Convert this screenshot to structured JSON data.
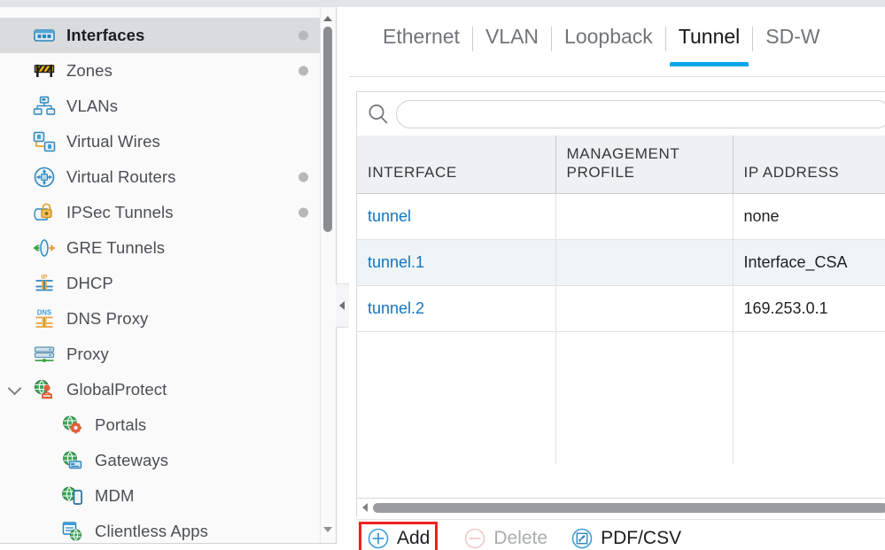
{
  "sidebar": {
    "items": [
      {
        "label": "Interfaces",
        "icon": "interfaces-icon",
        "selected": true,
        "dot": true,
        "child": false,
        "chevron": false
      },
      {
        "label": "Zones",
        "icon": "zones-icon",
        "selected": false,
        "dot": true,
        "child": false,
        "chevron": false
      },
      {
        "label": "VLANs",
        "icon": "vlans-icon",
        "selected": false,
        "dot": false,
        "child": false,
        "chevron": false
      },
      {
        "label": "Virtual Wires",
        "icon": "virtual-wires-icon",
        "selected": false,
        "dot": false,
        "child": false,
        "chevron": false
      },
      {
        "label": "Virtual Routers",
        "icon": "virtual-routers-icon",
        "selected": false,
        "dot": true,
        "child": false,
        "chevron": false
      },
      {
        "label": "IPSec Tunnels",
        "icon": "ipsec-tunnels-icon",
        "selected": false,
        "dot": true,
        "child": false,
        "chevron": false
      },
      {
        "label": "GRE Tunnels",
        "icon": "gre-tunnels-icon",
        "selected": false,
        "dot": false,
        "child": false,
        "chevron": false
      },
      {
        "label": "DHCP",
        "icon": "dhcp-icon",
        "selected": false,
        "dot": false,
        "child": false,
        "chevron": false
      },
      {
        "label": "DNS Proxy",
        "icon": "dns-proxy-icon",
        "selected": false,
        "dot": false,
        "child": false,
        "chevron": false
      },
      {
        "label": "Proxy",
        "icon": "proxy-icon",
        "selected": false,
        "dot": false,
        "child": false,
        "chevron": false
      },
      {
        "label": "GlobalProtect",
        "icon": "globalprotect-icon",
        "selected": false,
        "dot": false,
        "child": false,
        "chevron": true
      },
      {
        "label": "Portals",
        "icon": "portals-icon",
        "selected": false,
        "dot": false,
        "child": true,
        "chevron": false
      },
      {
        "label": "Gateways",
        "icon": "gateways-icon",
        "selected": false,
        "dot": false,
        "child": true,
        "chevron": false
      },
      {
        "label": "MDM",
        "icon": "mdm-icon",
        "selected": false,
        "dot": false,
        "child": true,
        "chevron": false
      },
      {
        "label": "Clientless Apps",
        "icon": "clientless-apps-icon",
        "selected": false,
        "dot": false,
        "child": true,
        "chevron": false
      }
    ]
  },
  "tabs": [
    {
      "label": "Ethernet",
      "active": false
    },
    {
      "label": "VLAN",
      "active": false
    },
    {
      "label": "Loopback",
      "active": false
    },
    {
      "label": "Tunnel",
      "active": true
    },
    {
      "label": "SD-W",
      "active": false
    }
  ],
  "search": {
    "value": "",
    "placeholder": ""
  },
  "table": {
    "columns": [
      "INTERFACE",
      "MANAGEMENT PROFILE",
      "IP ADDRESS"
    ],
    "rows": [
      {
        "interface": "tunnel",
        "management_profile": "",
        "ip_address": "none"
      },
      {
        "interface": "tunnel.1",
        "management_profile": "",
        "ip_address": "Interface_CSA"
      },
      {
        "interface": "tunnel.2",
        "management_profile": "",
        "ip_address": "169.253.0.1"
      }
    ]
  },
  "footer": {
    "add_label": "Add",
    "delete_label": "Delete",
    "pdfcsv_label": "PDF/CSV"
  },
  "colors": {
    "active_tab_underline": "#0aa5e8",
    "link": "#1475bf",
    "highlight_box": "#ef2020",
    "row_alt": "#eef4f7",
    "header_bg": "#eef0f1",
    "sidebar_selected_bg": "#d9dbdd"
  }
}
